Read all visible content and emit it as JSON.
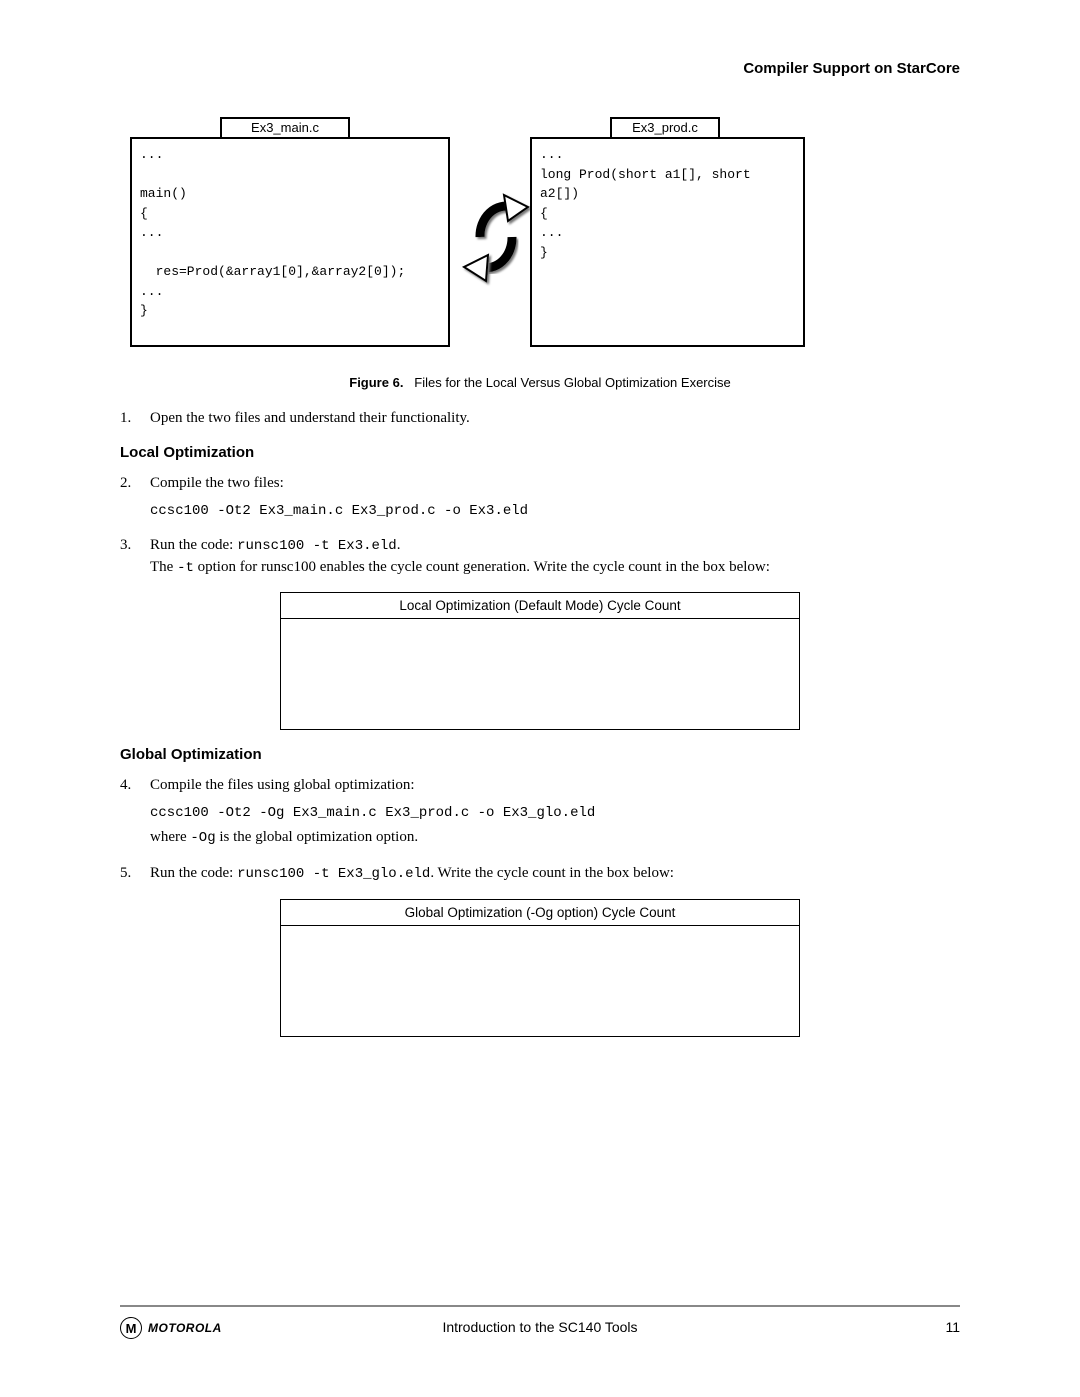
{
  "header": {
    "section_title": "Compiler Support on StarCore"
  },
  "figure": {
    "left_file": {
      "filename": "Ex3_main.c",
      "code": "...\n\nmain()\n{\n...\n\n  res=Prod(&array1[0],&array2[0]);\n...\n}"
    },
    "right_file": {
      "filename": "Ex3_prod.c",
      "code": "...\nlong Prod(short a1[], short\na2[])\n{\n...\n}"
    },
    "caption_label": "Figure 6.",
    "caption_text": "Files for the Local Versus Global Optimization Exercise"
  },
  "steps": {
    "s1": {
      "num": "1.",
      "text": "Open the two files and understand their functionality."
    },
    "local_heading": "Local Optimization",
    "s2": {
      "num": "2.",
      "text": "Compile the two files:",
      "cmd": "ccsc100 -Ot2 Ex3_main.c Ex3_prod.c -o Ex3.eld"
    },
    "s3": {
      "num": "3.",
      "prefix": "Run the code: ",
      "cmd_inline": "runsc100 -t Ex3.eld",
      "suffix": ".",
      "line2a": "The ",
      "line2_code": "-t",
      "line2b": " option for runsc100 enables the cycle count generation. Write the cycle count in the box below:"
    },
    "local_box_title": "Local Optimization (Default Mode) Cycle Count",
    "global_heading": "Global Optimization",
    "s4": {
      "num": "4.",
      "text": "Compile the files using global optimization:",
      "cmd": "ccsc100 -Ot2 -Og Ex3_main.c Ex3_prod.c -o Ex3_glo.eld",
      "where_a": "where ",
      "where_code": "-Og",
      "where_b": " is the global optimization option."
    },
    "s5": {
      "num": "5.",
      "prefix": "Run the code: ",
      "cmd_inline": "runsc100 -t Ex3_glo.eld",
      "suffix": ". Write the cycle count in the box below:"
    },
    "global_box_title": "Global Optimization (-Og option) Cycle Count"
  },
  "footer": {
    "brand": "MOTOROLA",
    "doc_title": "Introduction to the SC140 Tools",
    "page": "11"
  }
}
